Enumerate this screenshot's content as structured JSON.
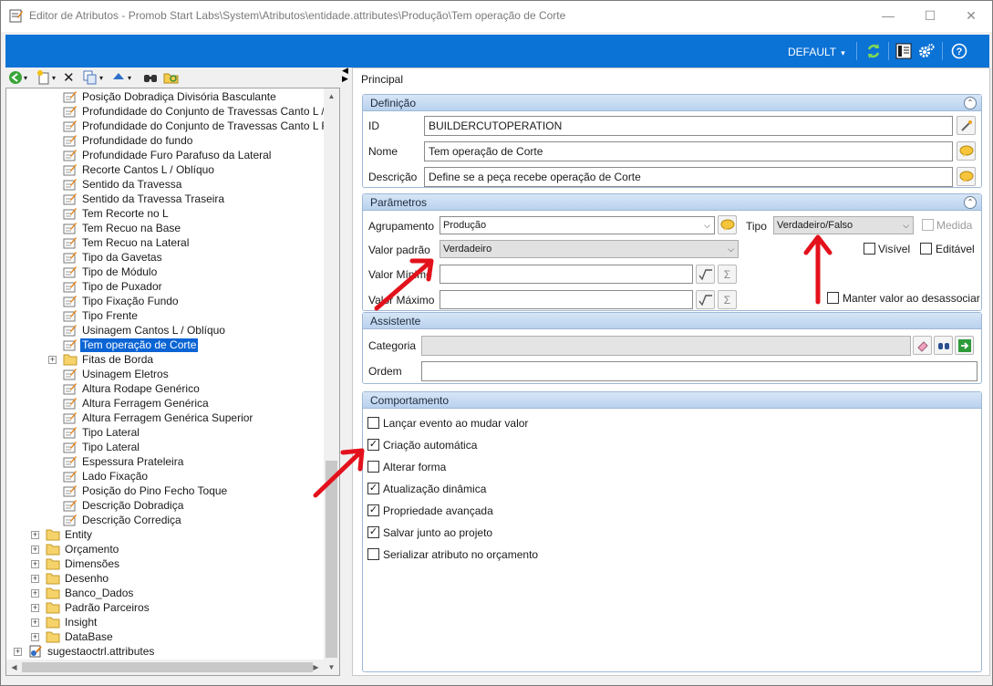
{
  "window": {
    "title": "Editor de Atributos - Promob Start Labs\\System\\Atributos\\entidade.attributes\\Produção\\Tem operação de Corte",
    "minimize": "—",
    "maximize": "☐",
    "close": "✕"
  },
  "topbar": {
    "profile_label": "DEFAULT",
    "profile_chevron": "▾",
    "icons": [
      "refresh-icon",
      "layout-icon",
      "settings-icon",
      "help-icon"
    ]
  },
  "tree": {
    "items": [
      {
        "label": "Posição Dobradiça Divisória Basculante",
        "type": "attribute"
      },
      {
        "label": "Profundidade do Conjunto de Travessas Canto L / Obl",
        "type": "attribute"
      },
      {
        "label": "Profundidade do Conjunto de Travessas Canto L Fren",
        "type": "attribute"
      },
      {
        "label": "Profundidade do fundo",
        "type": "attribute"
      },
      {
        "label": "Profundidade Furo Parafuso da Lateral",
        "type": "attribute"
      },
      {
        "label": "Recorte Cantos L / Oblíquo",
        "type": "attribute"
      },
      {
        "label": "Sentido da Travessa",
        "type": "attribute"
      },
      {
        "label": "Sentido da Travessa Traseira",
        "type": "attribute"
      },
      {
        "label": "Tem Recorte no L",
        "type": "attribute"
      },
      {
        "label": "Tem Recuo na Base",
        "type": "attribute"
      },
      {
        "label": "Tem Recuo na Lateral",
        "type": "attribute"
      },
      {
        "label": "Tipo da Gavetas",
        "type": "attribute"
      },
      {
        "label": "Tipo de Módulo",
        "type": "attribute"
      },
      {
        "label": "Tipo de Puxador",
        "type": "attribute"
      },
      {
        "label": "Tipo Fixação Fundo",
        "type": "attribute"
      },
      {
        "label": "Tipo Frente",
        "type": "attribute"
      },
      {
        "label": "Usinagem Cantos L / Oblíquo",
        "type": "attribute"
      },
      {
        "label": "Tem operação de Corte",
        "type": "attribute",
        "selected": true
      },
      {
        "label": "Fitas de Borda",
        "type": "folder"
      },
      {
        "label": "Usinagem Eletros",
        "type": "attribute"
      },
      {
        "label": "Altura Rodape Genérico",
        "type": "attribute"
      },
      {
        "label": "Altura Ferragem Genérica",
        "type": "attribute"
      },
      {
        "label": "Altura Ferragem Genérica Superior",
        "type": "attribute"
      },
      {
        "label": "Tipo Lateral",
        "type": "attribute"
      },
      {
        "label": "Tipo Lateral",
        "type": "attribute"
      },
      {
        "label": "Espessura Prateleira",
        "type": "attribute"
      },
      {
        "label": "Lado Fixação",
        "type": "attribute"
      },
      {
        "label": "Posição do Pino Fecho Toque",
        "type": "attribute"
      },
      {
        "label": "Descrição Dobradiça",
        "type": "attribute"
      },
      {
        "label": "Descrição Corrediça",
        "type": "attribute"
      },
      {
        "label": "Entity",
        "type": "folder"
      },
      {
        "label": "Orçamento",
        "type": "folder"
      },
      {
        "label": "Dimensões",
        "type": "folder"
      },
      {
        "label": "Desenho",
        "type": "folder"
      },
      {
        "label": "Banco_Dados",
        "type": "folder"
      },
      {
        "label": "Padrão Parceiros",
        "type": "folder"
      },
      {
        "label": "Insight",
        "type": "folder"
      },
      {
        "label": "DataBase",
        "type": "folder"
      },
      {
        "label": "sugestaoctrl.attributes",
        "type": "file"
      }
    ]
  },
  "right": {
    "tab_label": "Principal",
    "definicao": {
      "header": "Definição",
      "id_label": "ID",
      "id_value": "BUILDERCUTOPERATION",
      "nome_label": "Nome",
      "nome_value": "Tem operação de Corte",
      "descricao_label": "Descrição",
      "descricao_value": "Define se a peça recebe operação de Corte"
    },
    "parametros": {
      "header": "Parâmetros",
      "agrupamento_label": "Agrupamento",
      "agrupamento_value": "Produção",
      "tipo_label": "Tipo",
      "tipo_value": "Verdadeiro/Falso",
      "medida_label": "Medida",
      "valor_padrao_label": "Valor padrão",
      "valor_padrao_value": "Verdadeiro",
      "visivel_label": "Visível",
      "editavel_label": "Editável",
      "valor_minimo_label": "Valor Mínimo",
      "valor_maximo_label": "Valor Máximo",
      "manter_label": "Manter valor ao desassociar"
    },
    "assistente": {
      "header": "Assistente",
      "categoria_label": "Categoria",
      "ordem_label": "Ordem"
    },
    "comportamento": {
      "header": "Comportamento",
      "options": [
        {
          "label": "Lançar evento ao mudar valor",
          "checked": false
        },
        {
          "label": "Criação automática",
          "checked": true
        },
        {
          "label": "Alterar forma",
          "checked": false
        },
        {
          "label": "Atualização dinâmica",
          "checked": true
        },
        {
          "label": "Propriedade avançada",
          "checked": true
        },
        {
          "label": "Salvar junto ao projeto",
          "checked": true
        },
        {
          "label": "Serializar atributo no orçamento",
          "checked": false
        }
      ]
    }
  },
  "colors": {
    "topbar": "#0b72d6",
    "selection": "#0a64d4",
    "annotation_arrow": "#e3111b",
    "group_header": "#c9dcf3"
  }
}
